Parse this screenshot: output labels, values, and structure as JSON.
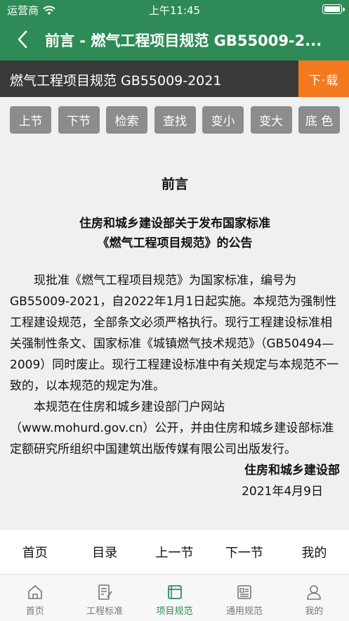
{
  "status": {
    "carrier": "运营商",
    "time": "上午11:45"
  },
  "nav": {
    "title": "前言 - 燃气工程项目规范 GB55009-2..."
  },
  "doc": {
    "title": "燃气工程项目规范 GB55009-2021",
    "download_label": "下·载"
  },
  "toolbar": {
    "buttons": [
      "上节",
      "下节",
      "检索",
      "查找",
      "变小",
      "变大",
      "底 色"
    ]
  },
  "content": {
    "heading": "前言",
    "subheading_line1": "住房和城乡建设部关于发布国家标准",
    "subheading_line2": "《燃气工程项目规范》的公告",
    "para1": "现批准《燃气工程项目规范》为国家标准，编号为GB55009-2021，自2022年1月1日起实施。本规范为强制性工程建设规范，全部条文必须严格执行。现行工程建设标准相关强制性条文、国家标准《城镇燃气技术规范》（GB50494—2009）同时废止。现行工程建设标准中有关规定与本规范不一致的，以本规范的规定为准。",
    "para2": "本规范在住房和城乡建设部门户网站（www.mohurd.gov.cn）公开，并由住房和城乡建设部标准定额研究所组织中国建筑出版传媒有限公司出版发行。",
    "signature": "住房和城乡建设部",
    "date": "2021年4月9日"
  },
  "quick_nav": [
    "首页",
    "目录",
    "上一节",
    "下一节",
    "我的"
  ],
  "tabs": [
    {
      "label": "首页",
      "icon": "home-icon"
    },
    {
      "label": "工程标准",
      "icon": "document-edit-icon"
    },
    {
      "label": "项目规范",
      "icon": "book-icon"
    },
    {
      "label": "通用规范",
      "icon": "news-icon"
    },
    {
      "label": "我的",
      "icon": "user-icon"
    }
  ],
  "active_tab_index": 2,
  "colors": {
    "primary": "#2e8b57",
    "download": "#f47a20",
    "header_dark": "#3a3a3a",
    "button_gray": "#8c8c8c"
  }
}
